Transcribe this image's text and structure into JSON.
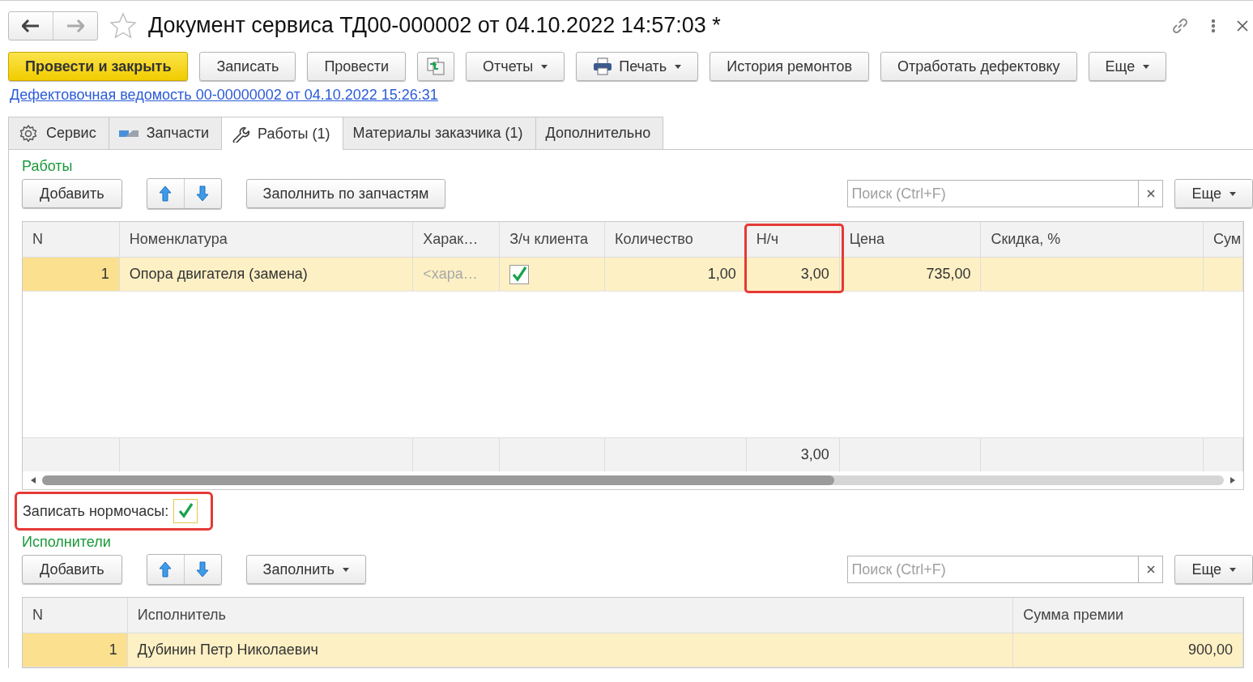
{
  "window": {
    "title": "Документ сервиса ТД00-000002 от 04.10.2022 14:57:03 *"
  },
  "toolbar": [
    {
      "kind": "primary",
      "label": "Провести и закрыть"
    },
    {
      "kind": "button",
      "label": "Записать"
    },
    {
      "kind": "button",
      "label": "Провести"
    },
    {
      "kind": "icon"
    },
    {
      "kind": "menu",
      "label": "Отчеты"
    },
    {
      "kind": "print",
      "label": "Печать"
    },
    {
      "kind": "button",
      "label": "История ремонтов"
    },
    {
      "kind": "button",
      "label": "Отработать дефектовку"
    },
    {
      "kind": "menu",
      "label": "Еще"
    }
  ],
  "link": "Дефектовочная ведомость 00-00000002 от 04.10.2022 15:26:31",
  "tabs": [
    {
      "label": "Сервис",
      "kind": "gear",
      "selected": false
    },
    {
      "label": "Запчасти",
      "kind": "parts",
      "selected": false
    },
    {
      "label": "Работы (1)",
      "kind": "wrench",
      "selected": true
    },
    {
      "label": "Материалы заказчика (1)",
      "kind": "plain",
      "selected": false
    },
    {
      "label": "Дополнительно",
      "kind": "plain",
      "selected": false
    }
  ],
  "works": {
    "title": "Работы",
    "add": "Добавить",
    "fill": {
      "label": "Заполнить по запчастям",
      "menu": false
    },
    "search": {
      "placeholder": "Поиск (Ctrl+F)"
    },
    "more": "Еще",
    "table": {
      "columns": [
        {
          "label": "N",
          "highlighted": false
        },
        {
          "label": "Номенклатура",
          "highlighted": false
        },
        {
          "label": "Харак…",
          "highlighted": false
        },
        {
          "label": "З/ч клиента",
          "highlighted": false
        },
        {
          "label": "Количество",
          "highlighted": false
        },
        {
          "label": "Н/ч",
          "highlighted": true,
          "total": "3,00"
        },
        {
          "label": "Цена",
          "highlighted": false
        },
        {
          "label": "Скидка, %",
          "highlighted": false
        },
        {
          "label": "Сум",
          "highlighted": false
        }
      ],
      "rows": [
        {
          "selected": true,
          "cells": [
            "1",
            "Опора двигателя (замена)",
            {
              "placeholder": "<хара…"
            },
            {
              "checked": true
            },
            "1,00",
            "3,00",
            "735,00",
            null,
            null
          ]
        }
      ]
    }
  },
  "record_hours": {
    "label": "Записать нормочасы:",
    "checked": true,
    "highlighted": true
  },
  "performers": {
    "title": "Исполнители",
    "add": "Добавить",
    "fill": {
      "label": "Заполнить",
      "menu": true
    },
    "search": {
      "placeholder": "Поиск (Ctrl+F)"
    },
    "more": "Еще",
    "table": {
      "columns": [
        {
          "label": "N",
          "highlighted": false
        },
        {
          "label": "Исполнитель",
          "highlighted": false
        },
        {
          "label": "Сумма премии",
          "highlighted": false
        }
      ],
      "rows": [
        {
          "selected": true,
          "cells": [
            "1",
            "Дубинин Петр Николаевич",
            "900,00"
          ]
        }
      ]
    }
  }
}
